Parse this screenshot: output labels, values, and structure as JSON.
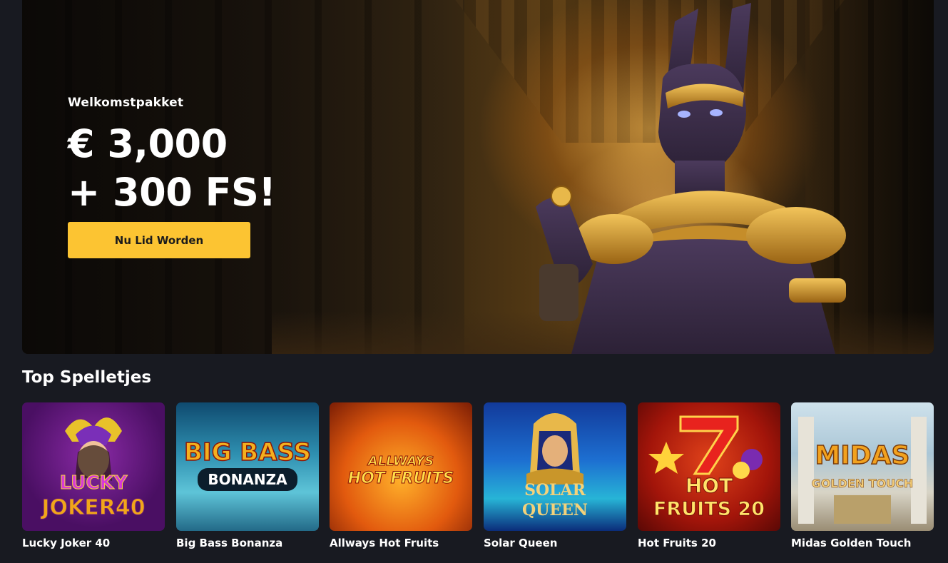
{
  "hero": {
    "label": "Welkomstpakket",
    "amount_line1": "€ 3,000",
    "amount_line2": "+ 300 FS!",
    "cta": "Nu Lid Worden",
    "cta_color": "#fcc432"
  },
  "top_games": {
    "title": "Top Spelletjes",
    "games": [
      {
        "name": "Lucky Joker 40",
        "thumb_text_1": "LUCKY",
        "thumb_text_2": "JOKER40"
      },
      {
        "name": "Big Bass Bonanza",
        "thumb_text_1": "BIG BASS",
        "thumb_text_2": "BONANZA"
      },
      {
        "name": "Allways Hot Fruits",
        "thumb_text_1": "ALLWAYS",
        "thumb_text_2": "HOT FRUITS"
      },
      {
        "name": "Solar Queen",
        "thumb_text_1": "SOLAR",
        "thumb_text_2": "QUEEN"
      },
      {
        "name": "Hot Fruits 20",
        "thumb_text_1": "HOT",
        "thumb_text_2": "FRUITS 20"
      },
      {
        "name": "Midas Golden Touch",
        "thumb_text_1": "MIDAS",
        "thumb_text_2": "GOLDEN TOUCH"
      }
    ]
  },
  "colors": {
    "background": "#181a21",
    "accent": "#fcc432"
  }
}
